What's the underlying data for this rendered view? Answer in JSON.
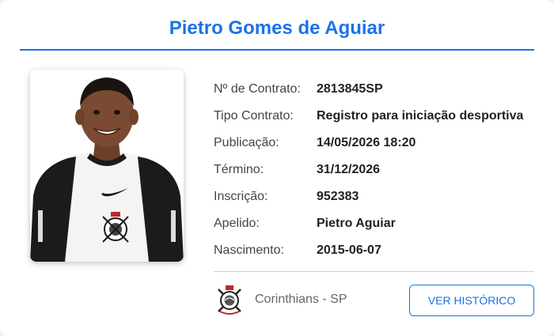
{
  "profile": {
    "name": "Pietro Gomes de Aguiar",
    "photo_icon": "player-photo",
    "fields": [
      {
        "label": "Nº de Contrato:",
        "value": "2813845SP"
      },
      {
        "label": "Tipo Contrato:",
        "value": "Registro para iniciação desportiva"
      },
      {
        "label": "Publicação:",
        "value": "14/05/2026 18:20"
      },
      {
        "label": "Término:",
        "value": "31/12/2026"
      },
      {
        "label": "Inscrição:",
        "value": "952383"
      },
      {
        "label": "Apelido:",
        "value": "Pietro Aguiar"
      },
      {
        "label": "Nascimento:",
        "value": "2015-06-07"
      }
    ]
  },
  "club": {
    "name": "Corinthians - SP",
    "logo_icon": "corinthians-crest-icon"
  },
  "actions": {
    "history_label": "VER HISTÓRICO"
  },
  "colors": {
    "accent": "#1a73e8",
    "jersey_black": "#1b1b1b"
  }
}
